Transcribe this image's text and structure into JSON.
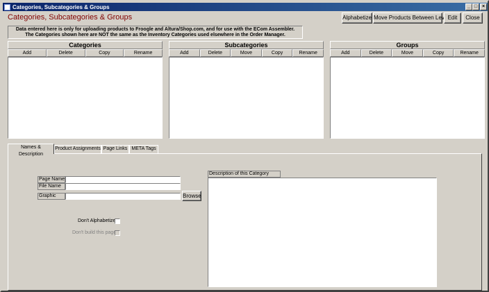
{
  "window": {
    "title": "Categories, Subcategories & Groups",
    "minimize": "_",
    "maximize": "□",
    "close": "×"
  },
  "heading": "Categories, Subcategories & Groups",
  "toolbar": {
    "alphabetize": "Alphabetize",
    "move_products": "Move Products Between Levels",
    "edit": "Edit",
    "close": "Close"
  },
  "notice": {
    "line1": "Data entered here is only for uploading products to Froogle and Altura/Shop.com, and for use with the ECom Assembler.",
    "line2": "The Categories shown here are NOT the same as the Inventory Categories used elsewhere in the Order Manager."
  },
  "categories": {
    "title": "Categories",
    "buttons": [
      "Add",
      "Delete",
      "Copy",
      "Rename"
    ]
  },
  "subcategories": {
    "title": "Subcategories",
    "buttons": [
      "Add",
      "Delete",
      "Move",
      "Copy",
      "Rename"
    ]
  },
  "groups": {
    "title": "Groups",
    "buttons": [
      "Add",
      "Delete",
      "Move",
      "Copy",
      "Rename"
    ]
  },
  "tabs": [
    {
      "label": "Names & Description",
      "active": true
    },
    {
      "label": "Product Assignments",
      "active": false
    },
    {
      "label": "Page Links",
      "active": false
    },
    {
      "label": "META Tags",
      "active": false
    }
  ],
  "form": {
    "page_name_label": "Page Name",
    "page_name_value": "",
    "file_name_label": "File Name",
    "file_name_value": "",
    "graphic_label": "Graphic",
    "graphic_value": "",
    "browse": "Browse",
    "dont_alphabetize": "Don't Alphabetize",
    "dont_build": "Don't build this page",
    "description_label": "Description of this Category",
    "description_value": ""
  }
}
